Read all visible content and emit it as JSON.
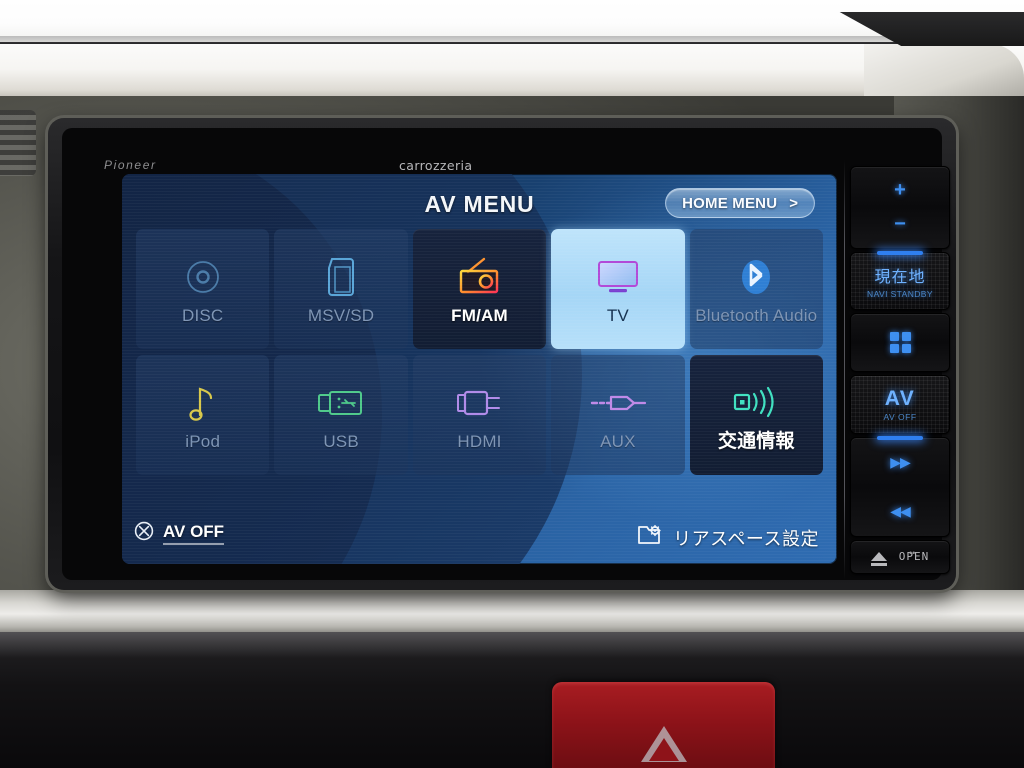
{
  "device": {
    "brand_left": "Pioneer",
    "brand_center": "carrozzeria"
  },
  "screen": {
    "title": "AV MENU",
    "home_menu": {
      "label": "HOME MENU",
      "chevron": ">"
    },
    "sources": [
      {
        "id": "disc",
        "label": "DISC",
        "icon": "disc-icon",
        "state": "dim"
      },
      {
        "id": "msvsd",
        "label": "MSV/SD",
        "icon": "sd-card-icon",
        "state": "dim"
      },
      {
        "id": "fmam",
        "label": "FM/AM",
        "icon": "radio-icon",
        "state": "active"
      },
      {
        "id": "tv",
        "label": "TV",
        "icon": "television-icon",
        "state": "selected"
      },
      {
        "id": "bt_audio",
        "label": "Bluetooth Audio",
        "icon": "bluetooth-icon",
        "state": "dim"
      },
      {
        "id": "ipod",
        "label": "iPod",
        "icon": "music-note-icon",
        "state": "dim"
      },
      {
        "id": "usb",
        "label": "USB",
        "icon": "usb-icon",
        "state": "dim"
      },
      {
        "id": "hdmi",
        "label": "HDMI",
        "icon": "hdmi-plug-icon",
        "state": "dim"
      },
      {
        "id": "aux",
        "label": "AUX",
        "icon": "aux-jack-icon",
        "state": "dim"
      },
      {
        "id": "traffic",
        "label": "交通情報",
        "icon": "broadcast-icon",
        "state": "active"
      }
    ],
    "av_off": {
      "label": "AV OFF",
      "icon": "circle-x-icon"
    },
    "rear_space": {
      "label": "リアスペース設定",
      "icon": "folder-gear-icon"
    }
  },
  "hardware_buttons": [
    {
      "id": "volume",
      "top_label": "+",
      "bottom_label": "−",
      "icon": "volume-rocker"
    },
    {
      "id": "navi",
      "top_label": "現在地",
      "bottom_label": "NAVI STANDBY",
      "icon": "navi-button"
    },
    {
      "id": "menu",
      "top_label": "",
      "bottom_label": "",
      "icon": "grid-menu-icon"
    },
    {
      "id": "av",
      "top_label": "AV",
      "bottom_label": "AV OFF",
      "icon": "av-button"
    },
    {
      "id": "track",
      "top_label": "▶▶",
      "bottom_label": "◀◀",
      "icon": "track-skip-icon"
    },
    {
      "id": "open",
      "top_label": "OPEN",
      "bottom_label": "",
      "icon": "eject-icon"
    }
  ],
  "colors": {
    "lcd_blue": "#2f6cb2",
    "lcd_navy": "#16294a",
    "selected_tile": "#a5d6f6",
    "active_text": "#ffffff",
    "dim_text": "#7d94b4",
    "button_glow": "#3e8ff0",
    "hazard_red": "#8e1319"
  }
}
